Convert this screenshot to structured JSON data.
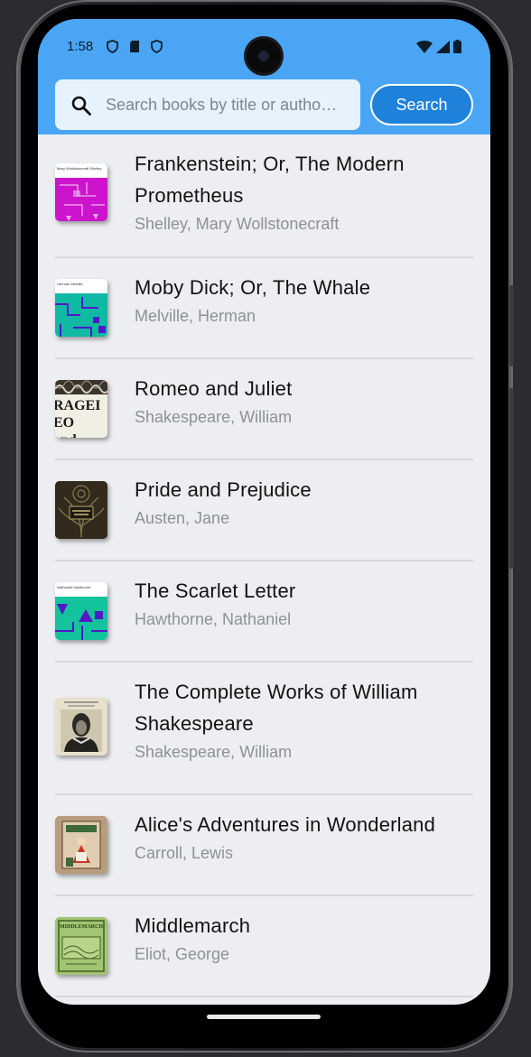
{
  "status": {
    "time": "1:58"
  },
  "search": {
    "placeholder": "Search books by title or autho…",
    "value": "",
    "button_label": "Search"
  },
  "books": [
    {
      "title": "Frankenstein; Or, The Modern Prometheus",
      "author": "Shelley, Mary Wollstonecraft",
      "cover_text": "Mary Wollstonecraft Shelley"
    },
    {
      "title": "Moby Dick; Or, The Whale",
      "author": "Melville, Herman",
      "cover_text": "Herman Melville"
    },
    {
      "title": "Romeo and Juliet",
      "author": "Shakespeare, William",
      "cover_text": "RAGEI EO and IV"
    },
    {
      "title": "Pride and Prejudice",
      "author": "Austen, Jane",
      "cover_text": ""
    },
    {
      "title": "The Scarlet Letter",
      "author": "Hawthorne, Nathaniel",
      "cover_text": "Nathaniel Hawthorne"
    },
    {
      "title": "The Complete Works of William Shakespeare",
      "author": "Shakespeare, William",
      "cover_text": ""
    },
    {
      "title": "Alice's Adventures in Wonderland",
      "author": "Carroll, Lewis",
      "cover_text": ""
    },
    {
      "title": "Middlemarch",
      "author": "Eliot, George",
      "cover_text": "MIDDLEMARCH"
    }
  ],
  "colors": {
    "app_bar": "#4aa6f5",
    "button": "#1f82da",
    "background": "#eceef1"
  },
  "icons": [
    "shield-icon",
    "sd-card-icon",
    "shield-icon",
    "wifi-icon",
    "cellular-icon",
    "battery-icon",
    "search-icon"
  ]
}
